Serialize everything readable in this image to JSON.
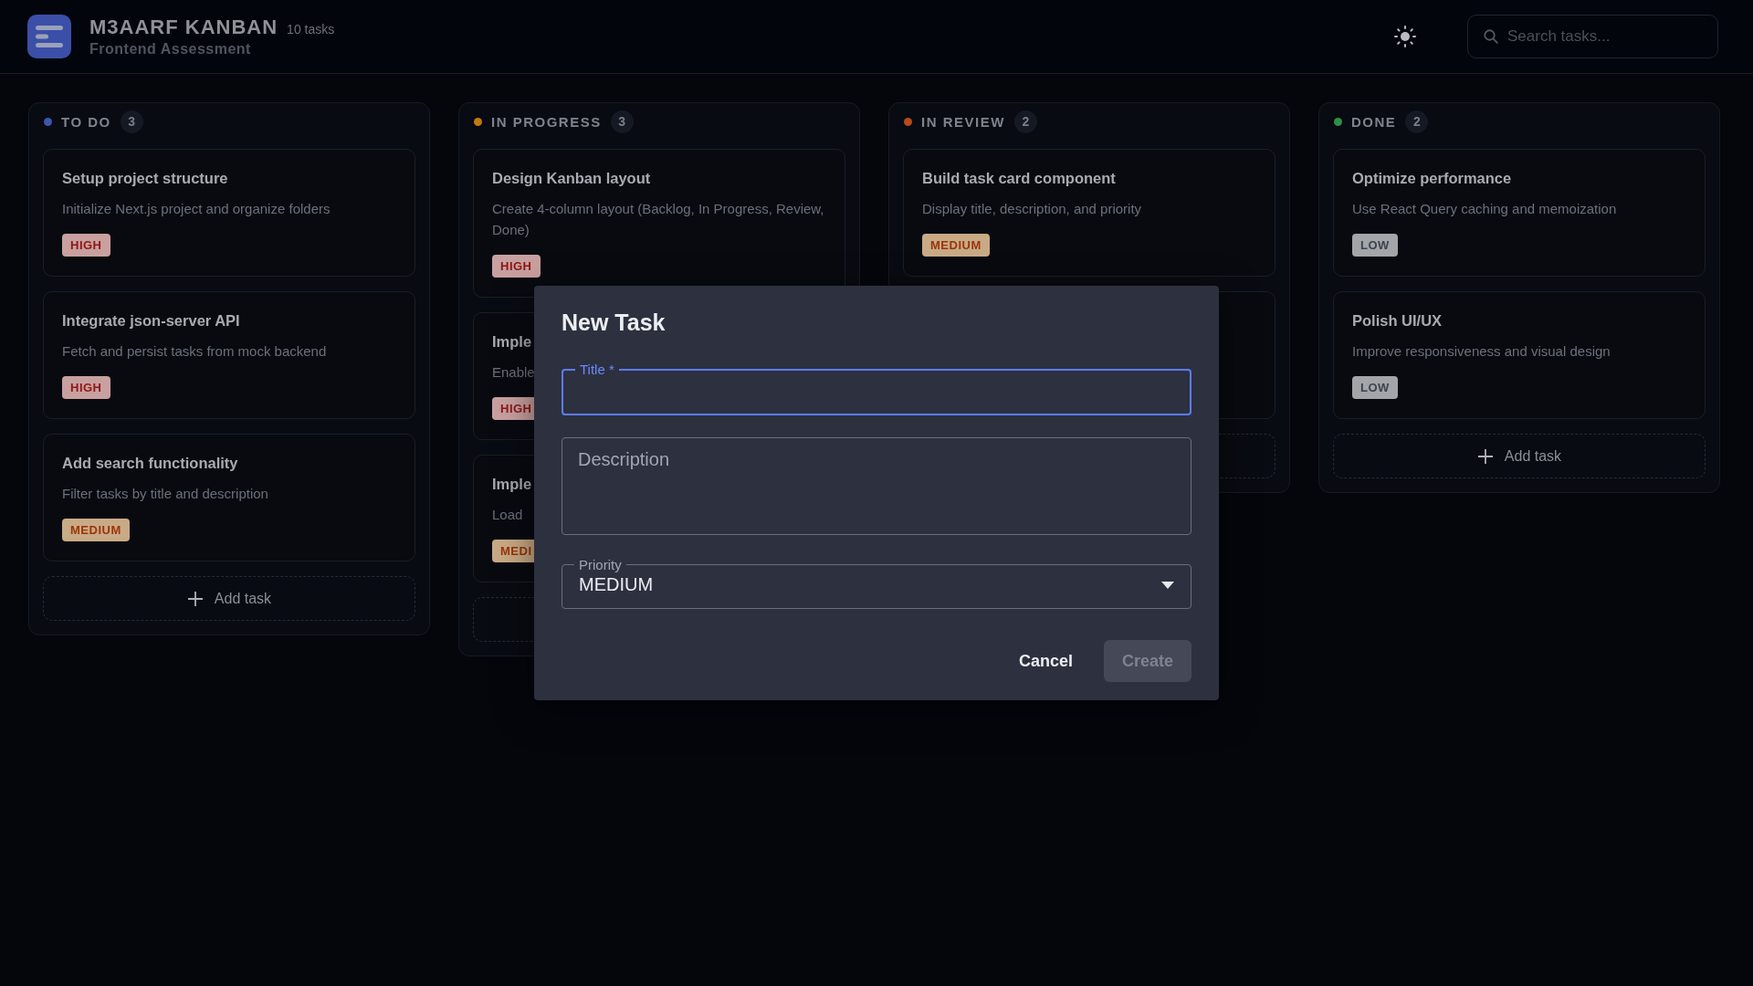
{
  "header": {
    "title": "M3AARF KANBAN",
    "count": "10 tasks",
    "subtitle": "Frontend Assessment",
    "search": {
      "placeholder": "Search tasks..."
    }
  },
  "columns": [
    {
      "name": "TO DO",
      "color": "#3d56b0",
      "count": "3",
      "add_label": "Add task",
      "cards": [
        {
          "kind": "task",
          "title": "Setup project structure",
          "description": "Initialize Next.js project and organize folders",
          "badge": {
            "label": "HIGH",
            "kind": "high"
          }
        },
        {
          "kind": "task",
          "title": "Integrate json-server API",
          "description": "Fetch and persist tasks from mock backend",
          "badge": {
            "label": "HIGH",
            "kind": "high"
          }
        },
        {
          "kind": "task",
          "title": "Add search functionality",
          "description": "Filter tasks by title and description",
          "badge": {
            "label": "MEDIUM",
            "kind": "medium"
          }
        }
      ]
    },
    {
      "name": "IN PROGRESS",
      "color": "#c07a10",
      "count": "3",
      "cards": [
        {
          "kind": "task",
          "title": "Design Kanban layout",
          "description": "Create 4-column layout (Backlog, In Progress, Review, Done)",
          "badge": {
            "label": "HIGH",
            "kind": "high"
          }
        },
        {
          "kind": "task",
          "title": "Imple",
          "description": "Enable",
          "badge": {
            "label": "HIGH",
            "kind": "high"
          }
        },
        {
          "kind": "task",
          "title": "Imple",
          "description": "Load",
          "badge": {
            "label": "MEDI",
            "kind": "medium"
          }
        }
      ]
    },
    {
      "name": "IN REVIEW",
      "color": "#b8491a",
      "count": "2",
      "cards": [
        {
          "kind": "task",
          "title": "Build task card component",
          "description": "Display title, description, and priority",
          "badge": {
            "label": "MEDIUM",
            "kind": "medium"
          }
        },
        {
          "kind": "covered"
        }
      ]
    },
    {
      "name": "DONE",
      "color": "#2f8f44",
      "count": "2",
      "add_label": "Add task",
      "cards": [
        {
          "kind": "task",
          "title": "Optimize performance",
          "description": "Use React Query caching and memoization",
          "badge": {
            "label": "LOW",
            "kind": "low"
          }
        },
        {
          "kind": "task",
          "title": "Polish UI/UX",
          "description": "Improve responsiveness and visual design",
          "badge": {
            "label": "LOW",
            "kind": "low"
          }
        }
      ]
    }
  ],
  "dialog": {
    "title": "New Task",
    "fields": [
      {
        "kind": "text",
        "label": "Title *",
        "focused": true
      },
      {
        "kind": "textarea",
        "placeholder": "Description",
        "focused": false
      },
      {
        "kind": "select",
        "label": "Priority",
        "value": "MEDIUM",
        "focused": false
      }
    ],
    "buttons": [
      {
        "label": "Cancel",
        "disabled": false
      },
      {
        "label": "Create",
        "disabled": true
      }
    ]
  }
}
